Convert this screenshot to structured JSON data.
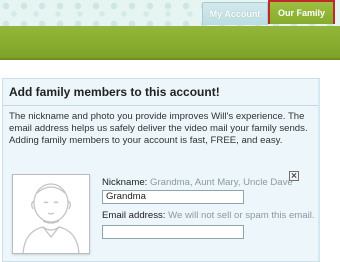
{
  "tabs": [
    {
      "label": "My Account"
    },
    {
      "label": "Our Family"
    }
  ],
  "panel": {
    "title": "Add family members to this account!",
    "intro": "The nickname and photo you provide improves Will's experience. The email address helps us safely deliver the video mail your family sends. Adding family members to your account is fast, FREE, and easy."
  },
  "form": {
    "nickname_label": "Nickname:",
    "nickname_hint": "Grandma, Aunt Mary, Uncle Dave",
    "nickname_value": "Grandma",
    "email_label": "Email address:",
    "email_hint": "We will not sell or spam this email.",
    "email_value": ""
  },
  "icons": {
    "avatar": "person-placeholder-icon",
    "remove": "close-icon"
  },
  "colors": {
    "accent_green": "#86ab2d",
    "active_tab_border": "#c0282c",
    "panel_bg": "#ecf6fb"
  }
}
